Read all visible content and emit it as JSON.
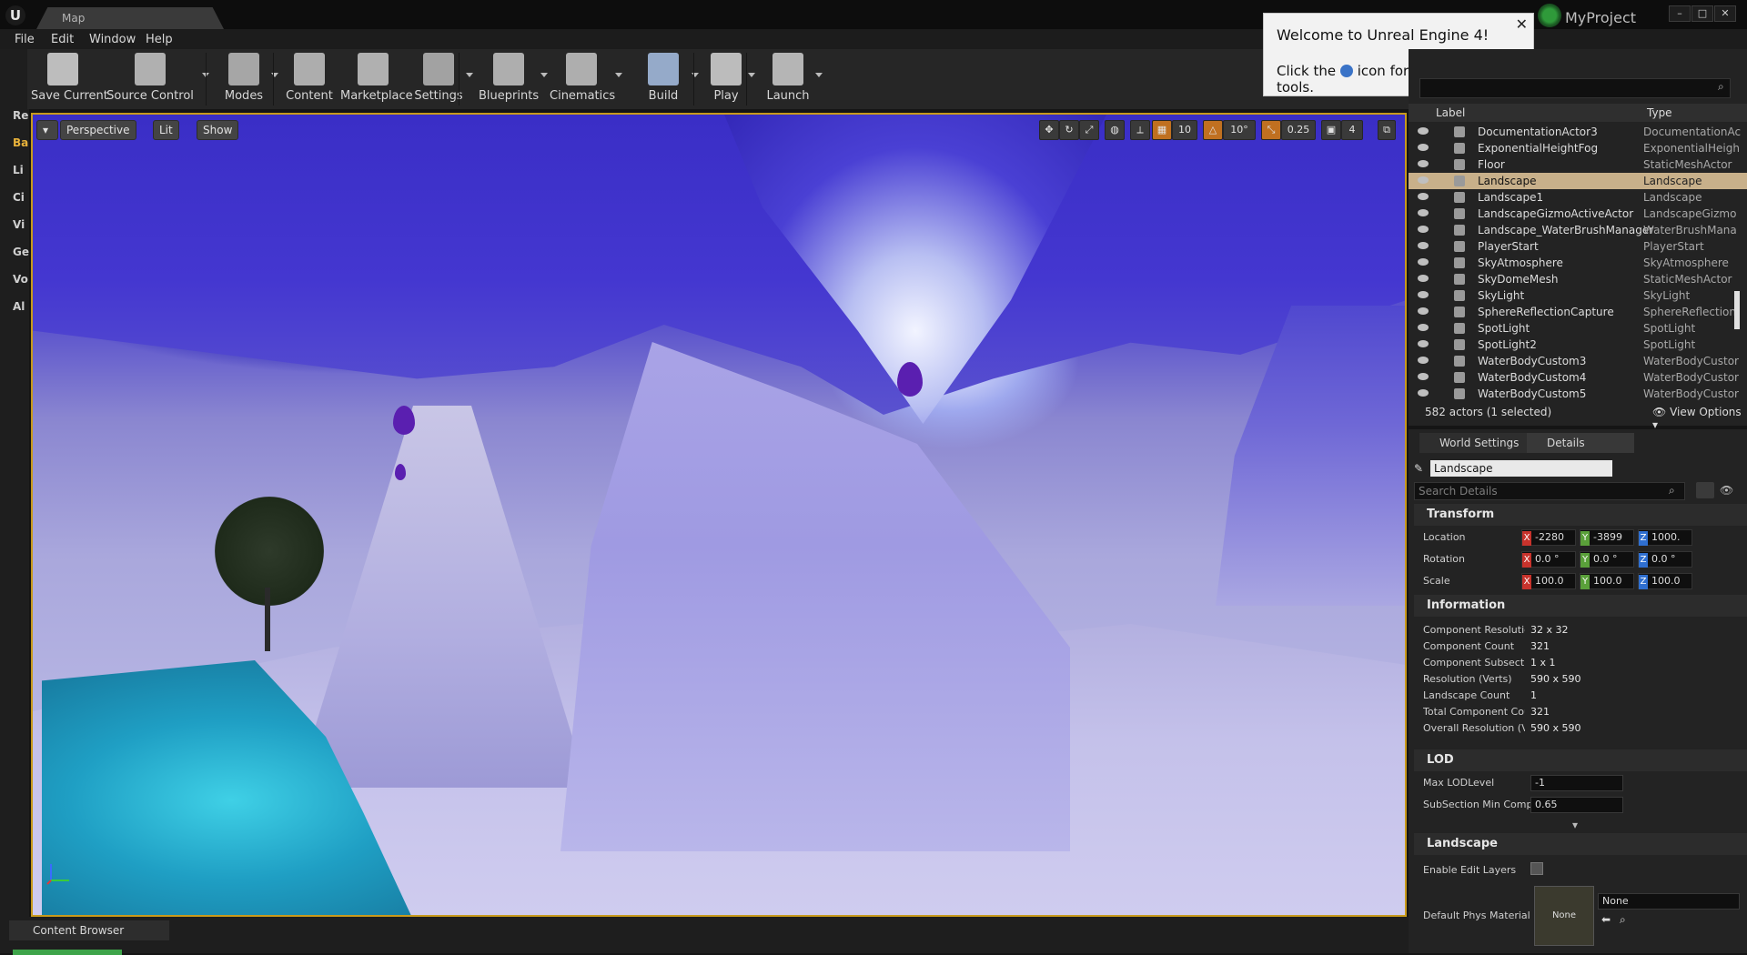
{
  "titlebar": {
    "tab_title": "Map",
    "project": "MyProject"
  },
  "menu": [
    "File",
    "Edit",
    "Window",
    "Help"
  ],
  "toolbar": [
    {
      "label": "Save Current",
      "icon": "save-icon",
      "arrow": false
    },
    {
      "label": "Source Control",
      "icon": "source-control-icon",
      "arrow": true
    },
    {
      "label": "Modes",
      "icon": "modes-icon",
      "arrow": true
    },
    {
      "label": "Content",
      "icon": "content-icon",
      "arrow": false
    },
    {
      "label": "Marketplace",
      "icon": "marketplace-icon",
      "arrow": false
    },
    {
      "label": "Settings",
      "icon": "settings-icon",
      "arrow": true
    },
    {
      "label": "Blueprints",
      "icon": "blueprints-icon",
      "arrow": true
    },
    {
      "label": "Cinematics",
      "icon": "cinematics-icon",
      "arrow": true
    },
    {
      "label": "Build",
      "icon": "build-icon",
      "arrow": true
    },
    {
      "label": "Play",
      "icon": "play-icon",
      "arrow": true
    },
    {
      "label": "Launch",
      "icon": "launch-icon",
      "arrow": true
    }
  ],
  "left_strip": [
    "Re",
    "Ba",
    "Li",
    "Ci",
    "Vi",
    "Ge",
    "Vo",
    "Al"
  ],
  "viewport": {
    "perspective": "Perspective",
    "lit": "Lit",
    "show": "Show",
    "grid_snap": "10",
    "rot_snap": "10°",
    "scale_snap": "0.25",
    "camera_speed": "4"
  },
  "welcome": {
    "title": "Welcome to Unreal Engine 4!",
    "body_before": "Click the",
    "body_after": "icon for a tour of the tools."
  },
  "outliner": {
    "columns": {
      "label": "Label",
      "type": "Type"
    },
    "rows": [
      {
        "label": "DocumentationActor3",
        "type": "DocumentationAc",
        "selected": false
      },
      {
        "label": "ExponentialHeightFog",
        "type": "ExponentialHeigh",
        "selected": false
      },
      {
        "label": "Floor",
        "type": "StaticMeshActor",
        "selected": false
      },
      {
        "label": "Landscape",
        "type": "Landscape",
        "selected": true
      },
      {
        "label": "Landscape1",
        "type": "Landscape",
        "selected": false
      },
      {
        "label": "LandscapeGizmoActiveActor",
        "type": "LandscapeGizmo",
        "selected": false
      },
      {
        "label": "Landscape_WaterBrushManager",
        "type": "WaterBrushMana",
        "selected": false
      },
      {
        "label": "PlayerStart",
        "type": "PlayerStart",
        "selected": false
      },
      {
        "label": "SkyAtmosphere",
        "type": "SkyAtmosphere",
        "selected": false
      },
      {
        "label": "SkyDomeMesh",
        "type": "StaticMeshActor",
        "selected": false
      },
      {
        "label": "SkyLight",
        "type": "SkyLight",
        "selected": false
      },
      {
        "label": "SphereReflectionCapture",
        "type": "SphereReflection(",
        "selected": false
      },
      {
        "label": "SpotLight",
        "type": "SpotLight",
        "selected": false
      },
      {
        "label": "SpotLight2",
        "type": "SpotLight",
        "selected": false
      },
      {
        "label": "WaterBodyCustom3",
        "type": "WaterBodyCustor",
        "selected": false
      },
      {
        "label": "WaterBodyCustom4",
        "type": "WaterBodyCustor",
        "selected": false
      },
      {
        "label": "WaterBodyCustom5",
        "type": "WaterBodyCustor",
        "selected": false
      }
    ],
    "status": "582 actors (1 selected)",
    "view_options": "View Options"
  },
  "details": {
    "tabs": [
      "World Settings",
      "Details"
    ],
    "actor_name": "Landscape",
    "search_placeholder": "Search Details",
    "transform": {
      "title": "Transform",
      "location": {
        "label": "Location",
        "x": "-2280",
        "y": "-3899",
        "z": "1000."
      },
      "rotation": {
        "label": "Rotation",
        "x": "0.0 °",
        "y": "0.0 °",
        "z": "0.0 °"
      },
      "scale": {
        "label": "Scale",
        "x": "100.0",
        "y": "100.0",
        "z": "100.0"
      }
    },
    "information": {
      "title": "Information",
      "rows": [
        {
          "label": "Component Resolutio",
          "value": "32 x 32"
        },
        {
          "label": "Component Count",
          "value": "321"
        },
        {
          "label": "Component Subsectic",
          "value": "1 x 1"
        },
        {
          "label": "Resolution (Verts)",
          "value": "590 x 590"
        },
        {
          "label": "Landscape Count",
          "value": "1"
        },
        {
          "label": "Total Component Cou",
          "value": "321"
        },
        {
          "label": "Overall Resolution (V",
          "value": "590 x 590"
        }
      ]
    },
    "lod": {
      "title": "LOD",
      "max_lod_label": "Max LODLevel",
      "max_lod_value": "-1",
      "subsection_label": "SubSection Min Comp",
      "subsection_value": "0.65"
    },
    "landscape": {
      "title": "Landscape",
      "edit_layers_label": "Enable Edit Layers",
      "phys_label": "Default Phys Material",
      "thumb_text": "None",
      "phys_value": "None"
    }
  },
  "bottom": {
    "content_browser": "Content Browser"
  }
}
